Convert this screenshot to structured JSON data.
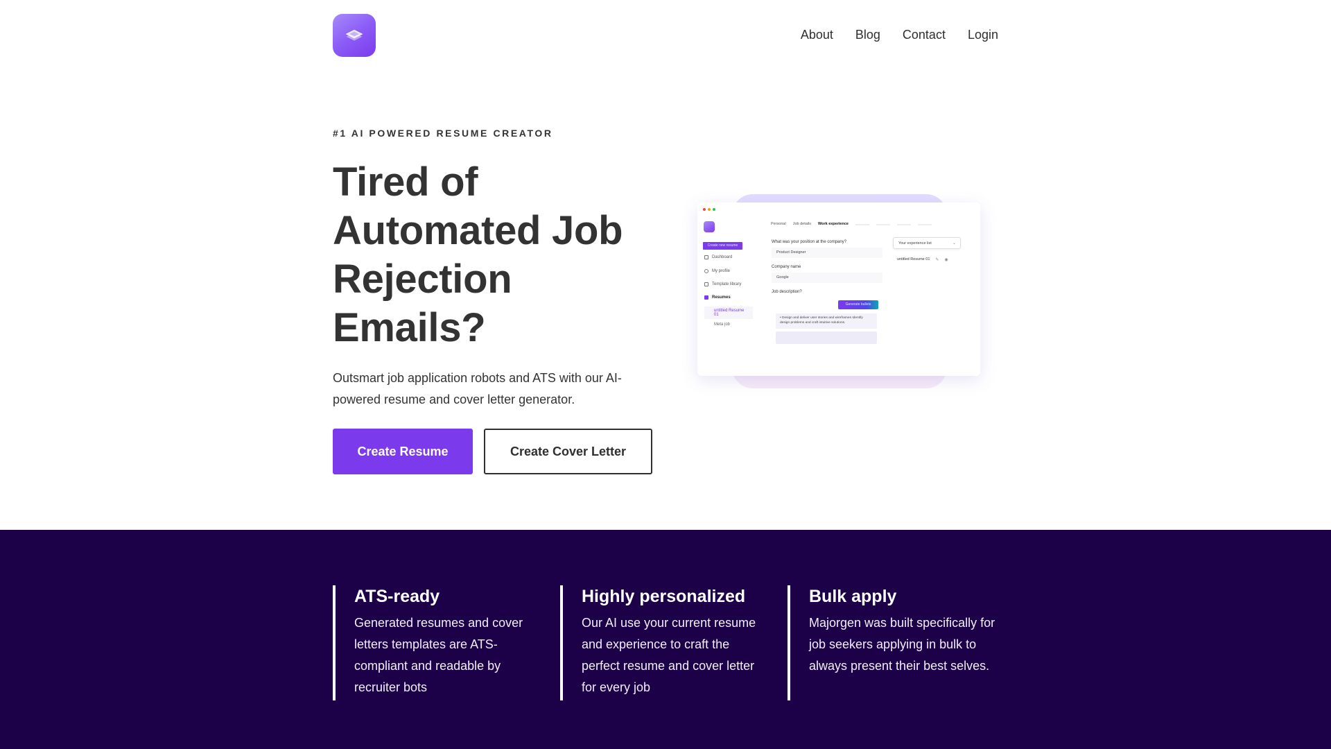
{
  "header": {
    "logo_icon": "layers-icon",
    "nav": [
      {
        "label": "About"
      },
      {
        "label": "Blog"
      },
      {
        "label": "Contact"
      },
      {
        "label": "Login"
      }
    ]
  },
  "hero": {
    "eyebrow": "#1 AI POWERED RESUME CREATOR",
    "headline": "Tired of Automated Job Rejection Emails?",
    "subtext": "Outsmart job application robots and ATS with our AI-powered resume and cover letter generator.",
    "primary_button": "Create Resume",
    "secondary_button": "Create Cover Letter",
    "accent_color": "#7c3aed"
  },
  "mockup": {
    "create_button": "Create new resume",
    "sidebar": [
      {
        "label": "Dashboard",
        "icon": "home-icon"
      },
      {
        "label": "My profile",
        "icon": "user-icon"
      },
      {
        "label": "Template library",
        "icon": "folder-icon"
      },
      {
        "label": "Resumes",
        "icon": "document-icon"
      }
    ],
    "resumes": [
      "untitled Resume 01",
      "Meta job"
    ],
    "tabs": [
      "Personal",
      "Job details",
      "Work experience"
    ],
    "position_label": "What was your position at the company?",
    "position_value": "Product Designer",
    "company_label": "Company name",
    "company_value": "Google",
    "job_desc_label": "Job description?",
    "generate_button": "Generate bullets",
    "bullet_text": "• Design and deliver user stories and wireframes Identify design problems and craft intuitive solutions.",
    "experience_select": "Your experience list",
    "experience_item": "untitled Resume 01"
  },
  "features": {
    "background": "#1c0048",
    "items": [
      {
        "title": "ATS-ready",
        "body": "Generated resumes and cover letters templates are ATS-compliant and readable by recruiter bots"
      },
      {
        "title": "Highly personalized",
        "body": "Our AI use your current resume and experience to craft the perfect resume and cover letter for every job"
      },
      {
        "title": "Bulk apply",
        "body": "Majorgen was built specifically for job seekers applying in bulk to always present their best selves."
      }
    ]
  }
}
